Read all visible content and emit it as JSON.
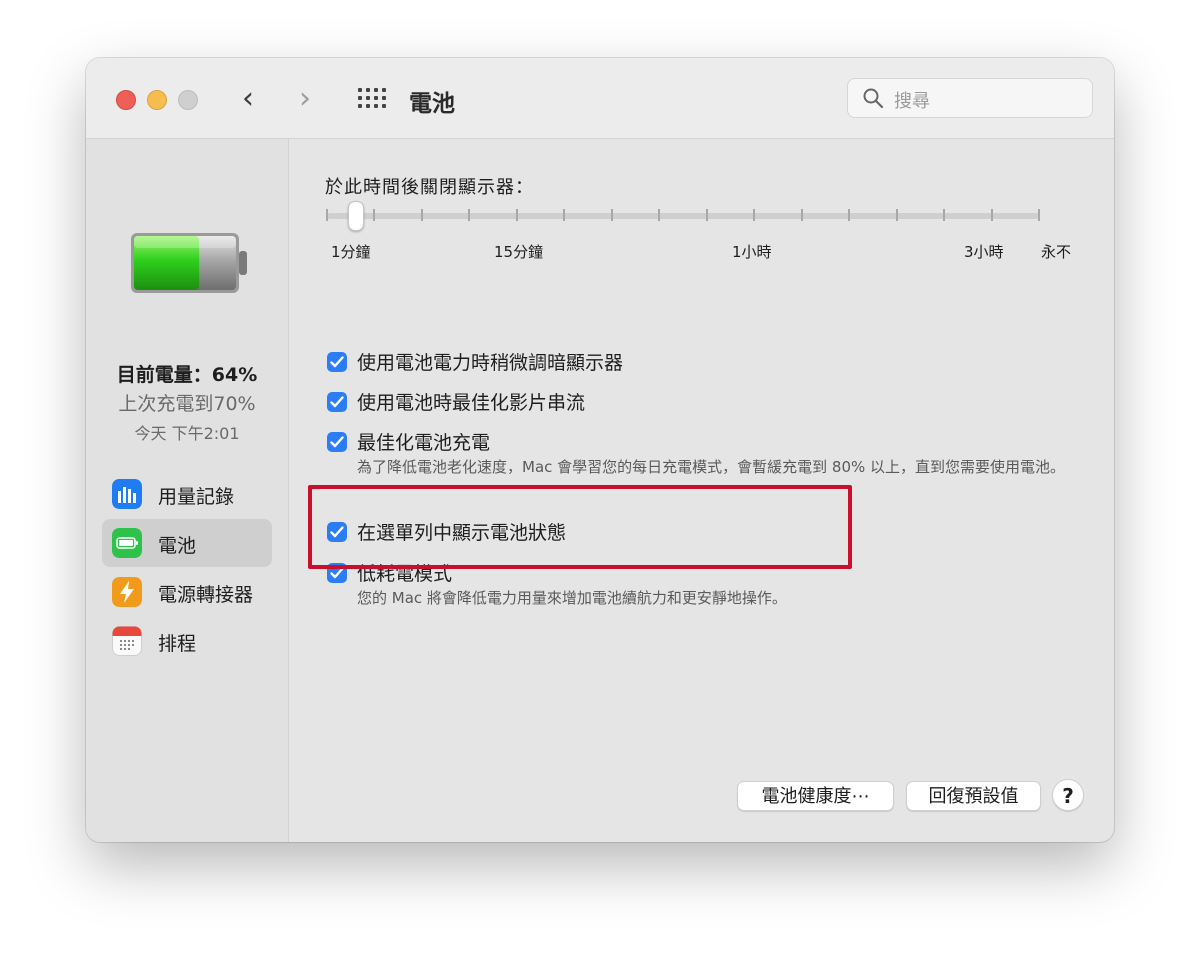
{
  "window": {
    "title": "電池",
    "search_placeholder": "搜尋",
    "nav_back": "‹",
    "nav_forward": "›"
  },
  "sidebar": {
    "current_charge": "目前電量：64%",
    "last_charged": "上次充電到70%",
    "last_charged_time": "今天 下午2:01",
    "items": [
      {
        "label": "用量記錄",
        "icon": "usage-history-icon",
        "color": "#1f7cf3",
        "selected": false
      },
      {
        "label": "電池",
        "icon": "battery-icon",
        "color": "#2ec24b",
        "selected": true
      },
      {
        "label": "電源轉接器",
        "icon": "power-adapter-icon",
        "color": "#f19b1c",
        "selected": false
      },
      {
        "label": "排程",
        "icon": "calendar-icon",
        "color": "#ffffff",
        "selected": false
      }
    ]
  },
  "display_sleep": {
    "label": "於此時間後關閉顯示器：",
    "value": "1分鐘",
    "tick_labels": [
      "1分鐘",
      "15分鐘",
      "1小時",
      "3小時",
      "永不"
    ]
  },
  "options": [
    {
      "label": "使用電池電力時稍微調暗顯示器",
      "checked": true,
      "description": ""
    },
    {
      "label": "使用電池時最佳化影片串流",
      "checked": true,
      "description": ""
    },
    {
      "label": "最佳化電池充電",
      "checked": true,
      "description": "為了降低電池老化速度，Mac 會學習您的每日充電模式，會暫緩充電到 80% 以上，直到您需要使用電池。"
    },
    {
      "label": "在選單列中顯示電池狀態",
      "checked": true,
      "description": ""
    },
    {
      "label": "低耗電模式",
      "checked": true,
      "description": "您的 Mac 將會降低電力用量來增加電池續航力和更安靜地操作。"
    }
  ],
  "buttons": {
    "battery_health": "電池健康度⋯",
    "restore_defaults": "回復預設值",
    "help": "?"
  },
  "colors": {
    "accent": "#2a7df5",
    "highlight": "#c8102e"
  }
}
